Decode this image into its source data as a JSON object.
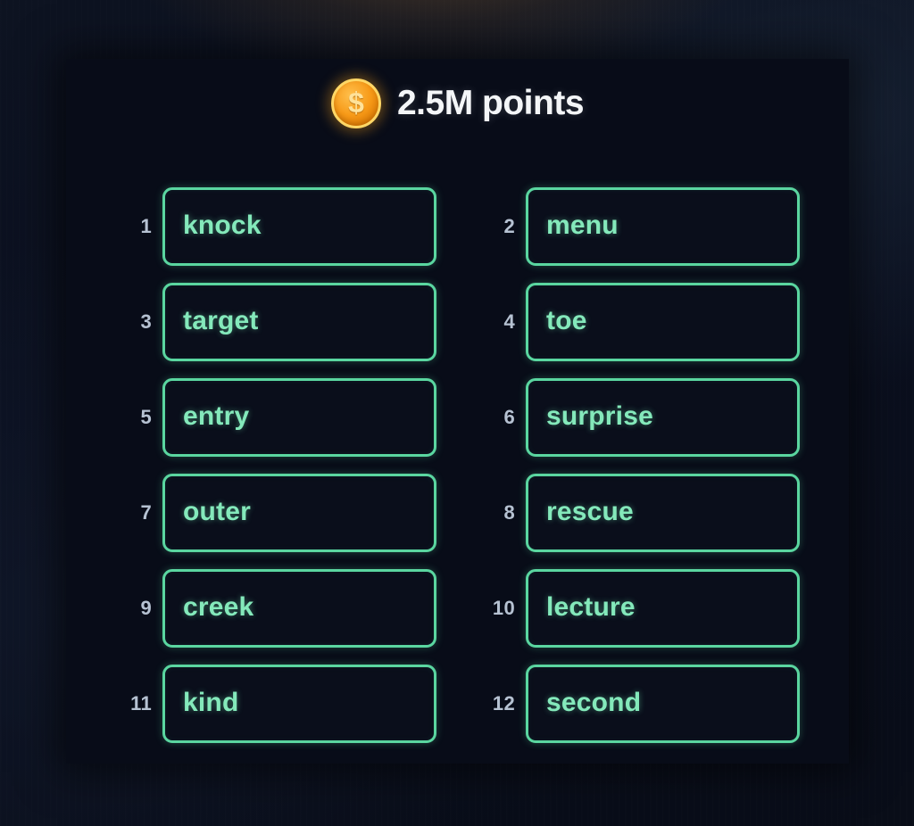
{
  "header": {
    "coin_icon": "coin-dollar-icon",
    "coin_symbol": "$",
    "points_label": "2.5M points"
  },
  "colors": {
    "panel_background": "#080c18",
    "page_background": "#0b1020",
    "box_border": "#5ad6a0",
    "box_fill": "#0a0e1b",
    "word_text": "#84e9bb",
    "index_text": "#b6c2d2",
    "points_text": "#f4f6f8",
    "coin_fill": "#f79a18",
    "coin_rim": "#ffd766"
  },
  "words": [
    {
      "index": "1",
      "text": "knock"
    },
    {
      "index": "2",
      "text": "menu"
    },
    {
      "index": "3",
      "text": "target"
    },
    {
      "index": "4",
      "text": "toe"
    },
    {
      "index": "5",
      "text": "entry"
    },
    {
      "index": "6",
      "text": "surprise"
    },
    {
      "index": "7",
      "text": "outer"
    },
    {
      "index": "8",
      "text": "rescue"
    },
    {
      "index": "9",
      "text": "creek"
    },
    {
      "index": "10",
      "text": "lecture"
    },
    {
      "index": "11",
      "text": "kind"
    },
    {
      "index": "12",
      "text": "second"
    }
  ]
}
